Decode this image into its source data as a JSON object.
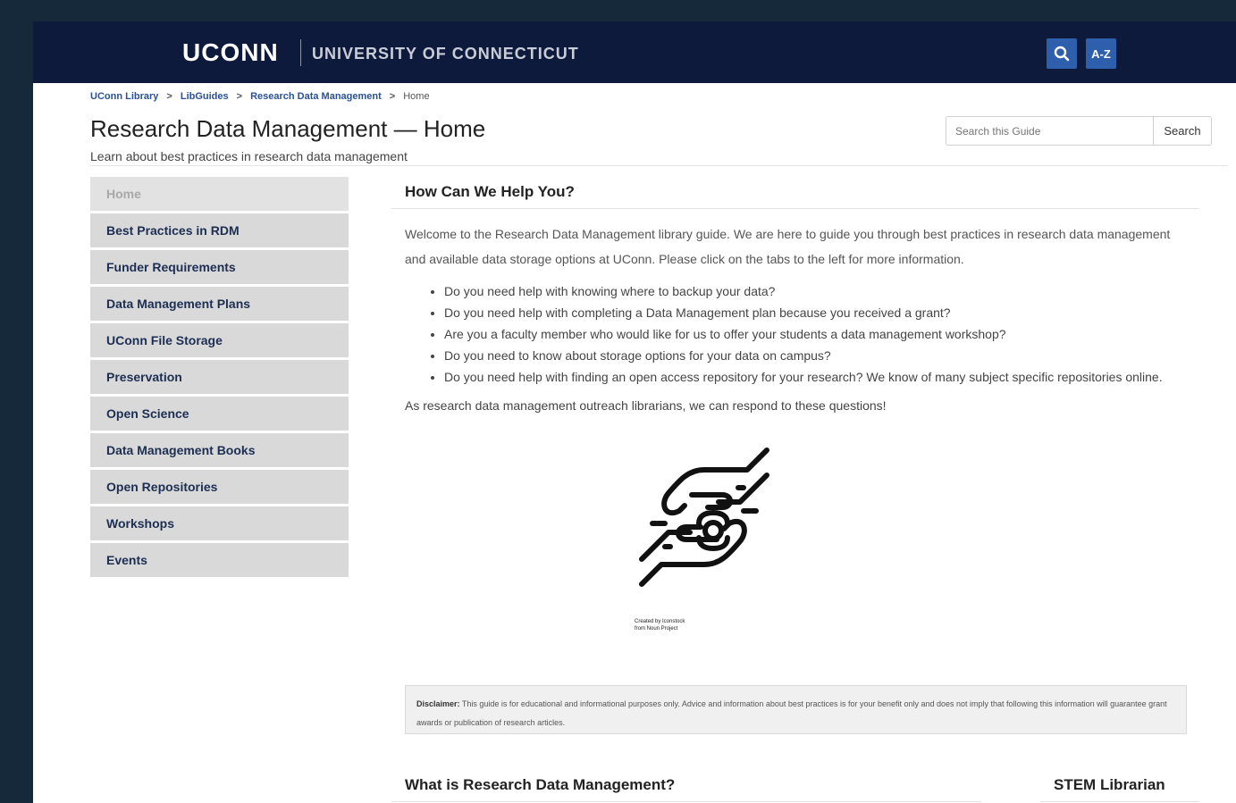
{
  "header": {
    "logo": "UCONN",
    "university": "UNIVERSITY OF CONNECTICUT",
    "az_label": "A-Z"
  },
  "breadcrumb": [
    {
      "label": "UConn Library"
    },
    {
      "label": "LibGuides"
    },
    {
      "label": "Research Data Management"
    },
    {
      "label": "Home"
    }
  ],
  "breadcrumb_separator": ">",
  "page": {
    "title": "Research Data Management — Home",
    "subtitle": "Learn about best practices in research data management"
  },
  "guide_search": {
    "placeholder": "Search this Guide",
    "button_label": "Search"
  },
  "sidebar": {
    "items": [
      {
        "label": "Home"
      },
      {
        "label": "Best Practices in RDM"
      },
      {
        "label": "Funder Requirements"
      },
      {
        "label": "Data Management Plans"
      },
      {
        "label": "UConn File Storage"
      },
      {
        "label": "Preservation"
      },
      {
        "label": "Open Science"
      },
      {
        "label": "Data Management Books"
      },
      {
        "label": "Open Repositories"
      },
      {
        "label": "Workshops"
      },
      {
        "label": "Events"
      }
    ]
  },
  "main": {
    "heading": "How Can We Help You?",
    "intro": "Welcome to the Research Data Management library guide.  We are here to guide you through best practices in research data management and available data storage options at UConn.  Please click on the tabs to the left for more information.",
    "bullets": [
      "Do you need help with knowing where to backup your data?",
      "Do you need help with completing a Data Management plan because you received a grant?",
      "Are you a faculty member who would like for us to offer your students a data management workshop?",
      "Do you need to know about storage options for your data on campus?",
      "Do you need help with finding an open access repository for your research?  We know of many subject specific repositories online."
    ],
    "closing": "As research data management outreach librarians, we can respond to these questions!",
    "image_credit_line1": "Created by Iconstock",
    "image_credit_line2": "from Noun Project",
    "disclaimer_label": "Disclaimer:",
    "disclaimer_text": "This guide is for educational and informational purposes only. Advice and information about best practices is for your benefit only and does not imply that following this information will guarantee grant awards or publication of research articles.",
    "what_heading": "What is Research Data Management?",
    "stem_heading": "STEM Librarian"
  }
}
